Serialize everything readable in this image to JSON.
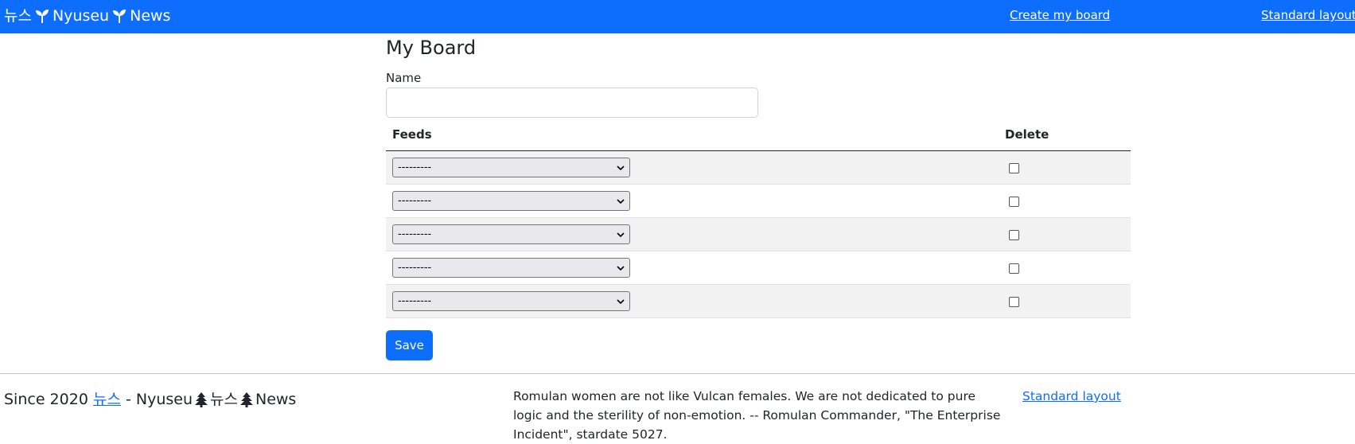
{
  "navbar": {
    "brand": {
      "part1": "뉴스",
      "part2": "Nyuseu",
      "part3": "News",
      "icon": "seedling-icon"
    },
    "create_board_link": "Create my board",
    "standard_layout_link": "Standard layout",
    "background_color": "#0d6efd"
  },
  "main": {
    "title": "My Board",
    "name_label": "Name",
    "name_value": "",
    "table": {
      "headers": {
        "feeds": "Feeds",
        "delete": "Delete"
      },
      "rows": [
        {
          "feed": "---------",
          "delete": false
        },
        {
          "feed": "---------",
          "delete": false
        },
        {
          "feed": "---------",
          "delete": false
        },
        {
          "feed": "---------",
          "delete": false
        },
        {
          "feed": "---------",
          "delete": false
        }
      ]
    },
    "save_label": "Save"
  },
  "footer": {
    "since_prefix": "Since 2020",
    "since_link": "뉴스",
    "since_middle": "- Nyuseu",
    "since_korean": "뉴스",
    "since_news": "News",
    "tree_icon": "evergreen-tree-icon",
    "quote": "Romulan women are not like Vulcan females. We are not dedicated to pure logic and the sterility of non-emotion. -- Romulan Commander, \"The Enterprise Incident\", stardate 5027.",
    "standard_layout_link": "Standard layout",
    "link_color": "#0d6efd"
  }
}
